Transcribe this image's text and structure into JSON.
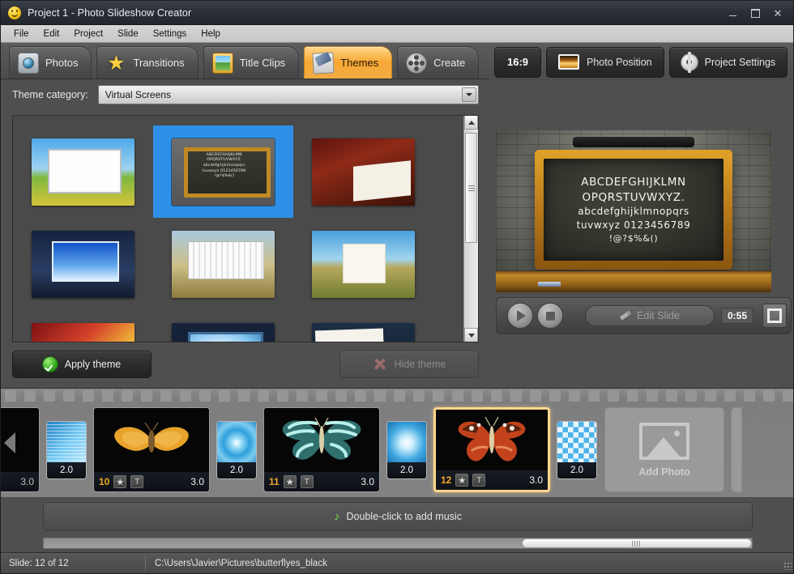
{
  "window": {
    "title": "Project 1 - Photo Slideshow Creator",
    "app_icon": "smiley-icon",
    "minimize": "–",
    "maximize": "□",
    "close": "✕"
  },
  "menu": {
    "items": [
      "File",
      "Edit",
      "Project",
      "Slide",
      "Settings",
      "Help"
    ]
  },
  "tabs": [
    {
      "label": "Photos",
      "icon": "camera-icon",
      "active": false
    },
    {
      "label": "Transitions",
      "icon": "star-icon",
      "active": false
    },
    {
      "label": "Title Clips",
      "icon": "title-clip-icon",
      "active": false
    },
    {
      "label": "Themes",
      "icon": "brush-icon",
      "active": true
    },
    {
      "label": "Create",
      "icon": "film-reel-icon",
      "active": false
    }
  ],
  "toolbar_right": {
    "aspect_ratio": "16:9",
    "photo_position": "Photo Position",
    "project_settings": "Project Settings"
  },
  "theme_panel": {
    "category_label": "Theme category:",
    "category_value": "Virtual Screens",
    "apply_label": "Apply theme",
    "hide_label": "Hide theme",
    "apply_enabled": true,
    "hide_enabled": false,
    "themes": [
      {
        "name": "meadow-frame",
        "art": "t-meadow",
        "selected": false
      },
      {
        "name": "chalkboard",
        "art": "t-chalk",
        "selected": true
      },
      {
        "name": "whisky-desk",
        "art": "t-whisky",
        "selected": false
      },
      {
        "name": "city-billboard",
        "art": "t-billboard",
        "selected": false
      },
      {
        "name": "field-billboard",
        "art": "t-field",
        "selected": false
      },
      {
        "name": "beach-sign",
        "art": "t-beach",
        "selected": false
      },
      {
        "name": "neon-cinema",
        "art": "t-neon",
        "selected": false
      },
      {
        "name": "blue-screen",
        "art": "t-screen",
        "selected": false
      },
      {
        "name": "studio-easel",
        "art": "t-easel",
        "selected": false
      }
    ],
    "thumb_chalk_lines": [
      "ABCDEFGHIJKLMN",
      "OPQRSTUVWXYZ.",
      "abcdefghijklmnopqrs",
      "tuvwxyz 0123456789",
      "!@?$%&()"
    ]
  },
  "preview": {
    "lines": [
      "ABCDEFGHIJKLMN",
      "OPQRSTUVWXYZ.",
      "abcdefghijklmnopqrs",
      "tuvwxyz 0123456789",
      "!@?$%&()"
    ],
    "play": "play-button",
    "stop": "stop-button",
    "edit_slide": "Edit Slide",
    "edit_slide_enabled": false,
    "timecode": "0:55",
    "fullscreen": "fullscreen-button"
  },
  "filmstrip": {
    "scroll_left": "◀",
    "items": [
      {
        "kind": "slide",
        "partial": true,
        "number": "",
        "duration": "3.0",
        "art": "partial",
        "selected": false
      },
      {
        "kind": "transition",
        "duration": "2.0",
        "art": "tr-lines"
      },
      {
        "kind": "slide",
        "partial": false,
        "number": "10",
        "duration": "3.0",
        "art": "moth",
        "selected": false,
        "badges": [
          "★",
          "T"
        ]
      },
      {
        "kind": "transition",
        "duration": "2.0",
        "art": "tr-spiral"
      },
      {
        "kind": "slide",
        "partial": false,
        "number": "11",
        "duration": "3.0",
        "art": "blue-butterfly",
        "selected": false,
        "badges": [
          "★",
          "T"
        ]
      },
      {
        "kind": "transition",
        "duration": "2.0",
        "art": "tr-burst"
      },
      {
        "kind": "slide",
        "partial": false,
        "number": "12",
        "duration": "3.0",
        "art": "red-butterfly",
        "selected": true,
        "badges": [
          "★",
          "T"
        ]
      },
      {
        "kind": "transition",
        "duration": "2.0",
        "art": "tr-check"
      },
      {
        "kind": "addphoto",
        "label": "Add Photo"
      }
    ]
  },
  "music": {
    "label": "Double-click to add music",
    "icon": "music-note-icon"
  },
  "status": {
    "slide_counter": "Slide: 12 of 12",
    "path": "C:\\Users\\Javier\\Pictures\\butterflyes_black"
  },
  "colors": {
    "accent_orange": "#f8a834",
    "selection_blue": "#2e8fe8",
    "selected_slide": "#ffd78e",
    "slide_number": "#f0a82a"
  }
}
